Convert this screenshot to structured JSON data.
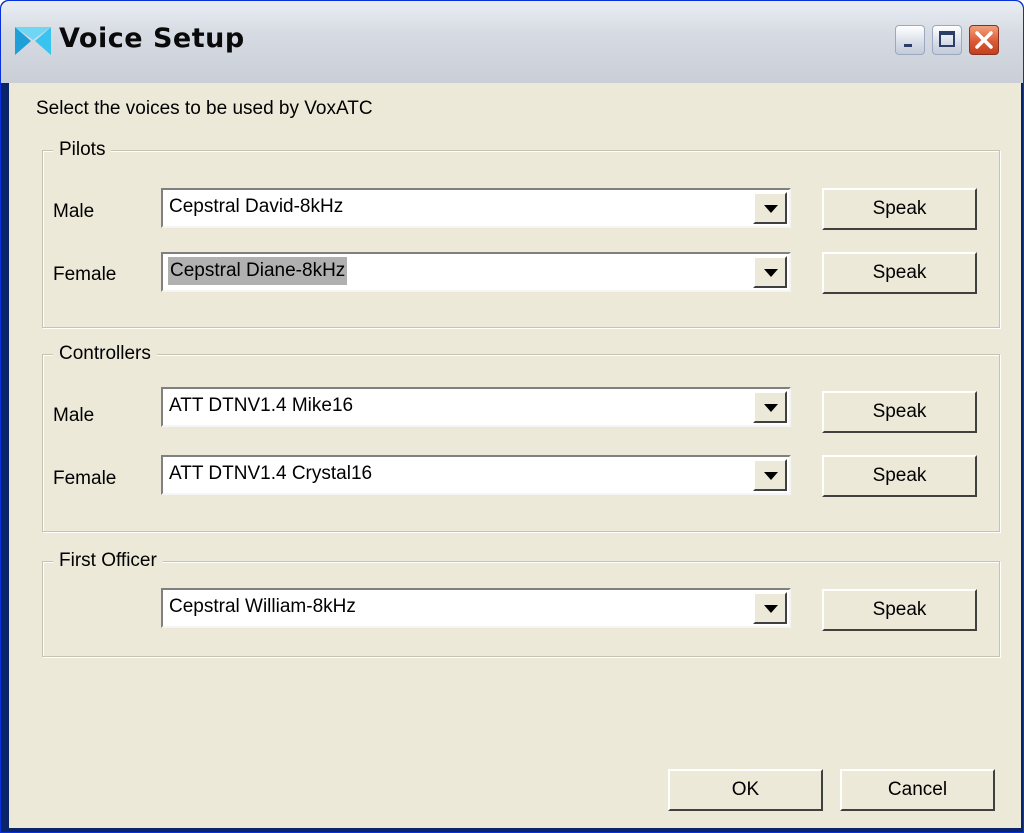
{
  "window": {
    "title": "Voice Setup"
  },
  "intro": "Select the voices to be used by VoxATC",
  "groups": {
    "pilots": {
      "title": "Pilots",
      "male": {
        "label": "Male",
        "value": "Cepstral David-8kHz"
      },
      "female": {
        "label": "Female",
        "value": "Cepstral Diane-8kHz"
      }
    },
    "controllers": {
      "title": "Controllers",
      "male": {
        "label": "Male",
        "value": "ATT DTNV1.4 Mike16"
      },
      "female": {
        "label": "Female",
        "value": "ATT DTNV1.4 Crystal16"
      }
    },
    "first_officer": {
      "title": "First Officer",
      "voice": {
        "value": "Cepstral William-8kHz"
      }
    }
  },
  "buttons": {
    "speak": "Speak",
    "ok": "OK",
    "cancel": "Cancel"
  },
  "colors": {
    "title_bar": "#d6dbe3",
    "dialog_bg": "#ece9d8",
    "close_button": "#db5a36",
    "selection": "#b0b0b0"
  }
}
